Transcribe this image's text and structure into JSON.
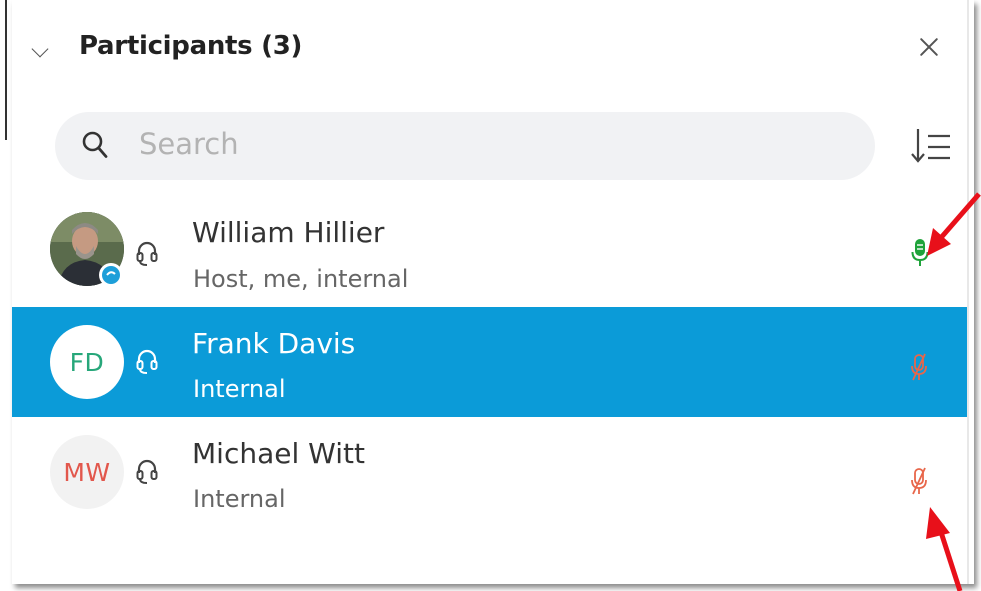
{
  "header": {
    "title": "Participants (3)"
  },
  "search": {
    "placeholder": "Search"
  },
  "participants": [
    {
      "name": "William Hillier",
      "role": "Host, me, internal",
      "initials": "",
      "avatar_type": "photo",
      "audio_icon": "headset-icon",
      "mic_status": "unmuted",
      "mic_color": "#1fa33a",
      "selected": false
    },
    {
      "name": "Frank Davis",
      "role": "Internal",
      "initials": "FD",
      "initials_color": "#27a77a",
      "avatar_type": "initials",
      "audio_icon": "headset-icon",
      "mic_status": "muted",
      "mic_color": "#e8664a",
      "selected": true
    },
    {
      "name": "Michael Witt",
      "role": "Internal",
      "initials": "MW",
      "initials_color": "#e2574c",
      "avatar_type": "initials",
      "audio_icon": "headset-icon",
      "mic_status": "muted",
      "mic_color": "#e8664a",
      "selected": false
    }
  ],
  "colors": {
    "selection": "#0b9bd8",
    "annotation_arrow": "#e8101a"
  }
}
